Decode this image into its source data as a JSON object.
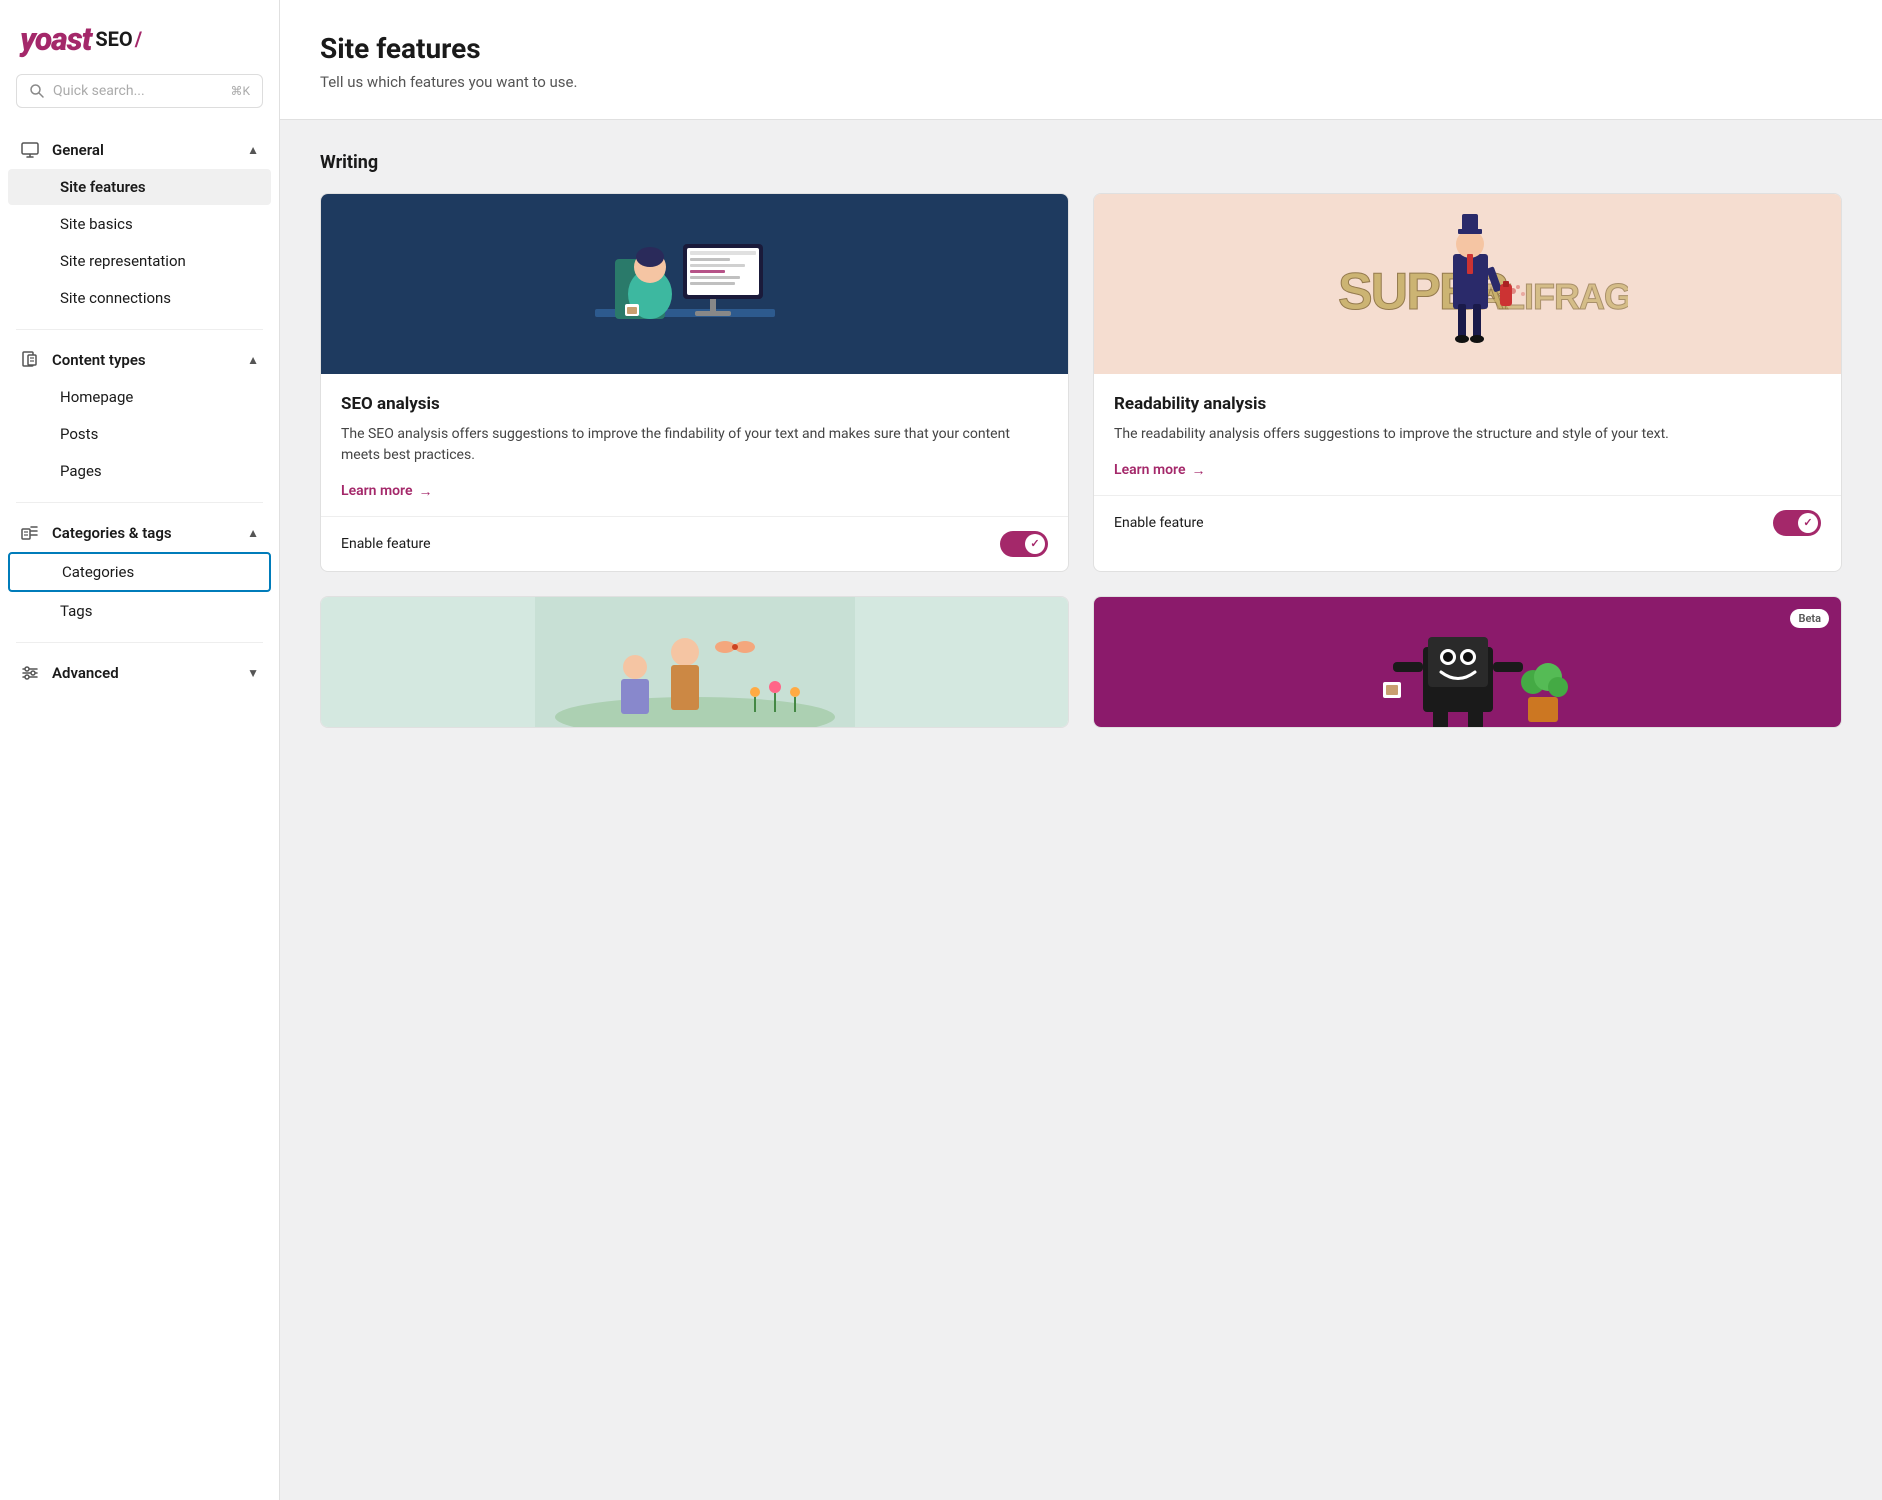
{
  "logo": {
    "yoast": "yoast",
    "seo": "SEO",
    "slash": "/"
  },
  "search": {
    "placeholder": "Quick search...",
    "shortcut": "⌘K"
  },
  "sidebar": {
    "sections": [
      {
        "id": "general",
        "icon": "monitor-icon",
        "title": "General",
        "expanded": true,
        "items": [
          {
            "id": "site-features",
            "label": "Site features",
            "active": true,
            "selected": false
          },
          {
            "id": "site-basics",
            "label": "Site basics",
            "active": false,
            "selected": false
          },
          {
            "id": "site-representation",
            "label": "Site representation",
            "active": false,
            "selected": false
          },
          {
            "id": "site-connections",
            "label": "Site connections",
            "active": false,
            "selected": false
          }
        ]
      },
      {
        "id": "content-types",
        "icon": "document-icon",
        "title": "Content types",
        "expanded": true,
        "items": [
          {
            "id": "homepage",
            "label": "Homepage",
            "active": false,
            "selected": false
          },
          {
            "id": "posts",
            "label": "Posts",
            "active": false,
            "selected": false
          },
          {
            "id": "pages",
            "label": "Pages",
            "active": false,
            "selected": false
          }
        ]
      },
      {
        "id": "categories-tags",
        "icon": "tags-icon",
        "title": "Categories & tags",
        "expanded": true,
        "items": [
          {
            "id": "categories",
            "label": "Categories",
            "active": false,
            "selected": true
          },
          {
            "id": "tags",
            "label": "Tags",
            "active": false,
            "selected": false
          }
        ]
      },
      {
        "id": "advanced",
        "icon": "sliders-icon",
        "title": "Advanced",
        "expanded": false,
        "items": []
      }
    ]
  },
  "page": {
    "title": "Site features",
    "subtitle": "Tell us which features you want to use."
  },
  "writing_section": {
    "heading": "Writing",
    "cards": [
      {
        "id": "seo-analysis",
        "title": "SEO analysis",
        "description": "The SEO analysis offers suggestions to improve the findability of your text and makes sure that your content meets best practices.",
        "learn_more": "Learn more",
        "enable_label": "Enable feature",
        "enabled": true,
        "beta": false,
        "image_style": "seo"
      },
      {
        "id": "readability-analysis",
        "title": "Readability analysis",
        "description": "The readability analysis offers suggestions to improve the structure and style of your text.",
        "learn_more": "Learn more",
        "enable_label": "Enable feature",
        "enabled": true,
        "beta": false,
        "image_style": "readability"
      },
      {
        "id": "third-feature",
        "title": "",
        "description": "",
        "learn_more": "",
        "enable_label": "",
        "enabled": false,
        "beta": false,
        "image_style": "third"
      },
      {
        "id": "fourth-feature",
        "title": "",
        "description": "",
        "learn_more": "",
        "enable_label": "",
        "enabled": false,
        "beta": true,
        "image_style": "fourth"
      }
    ]
  }
}
